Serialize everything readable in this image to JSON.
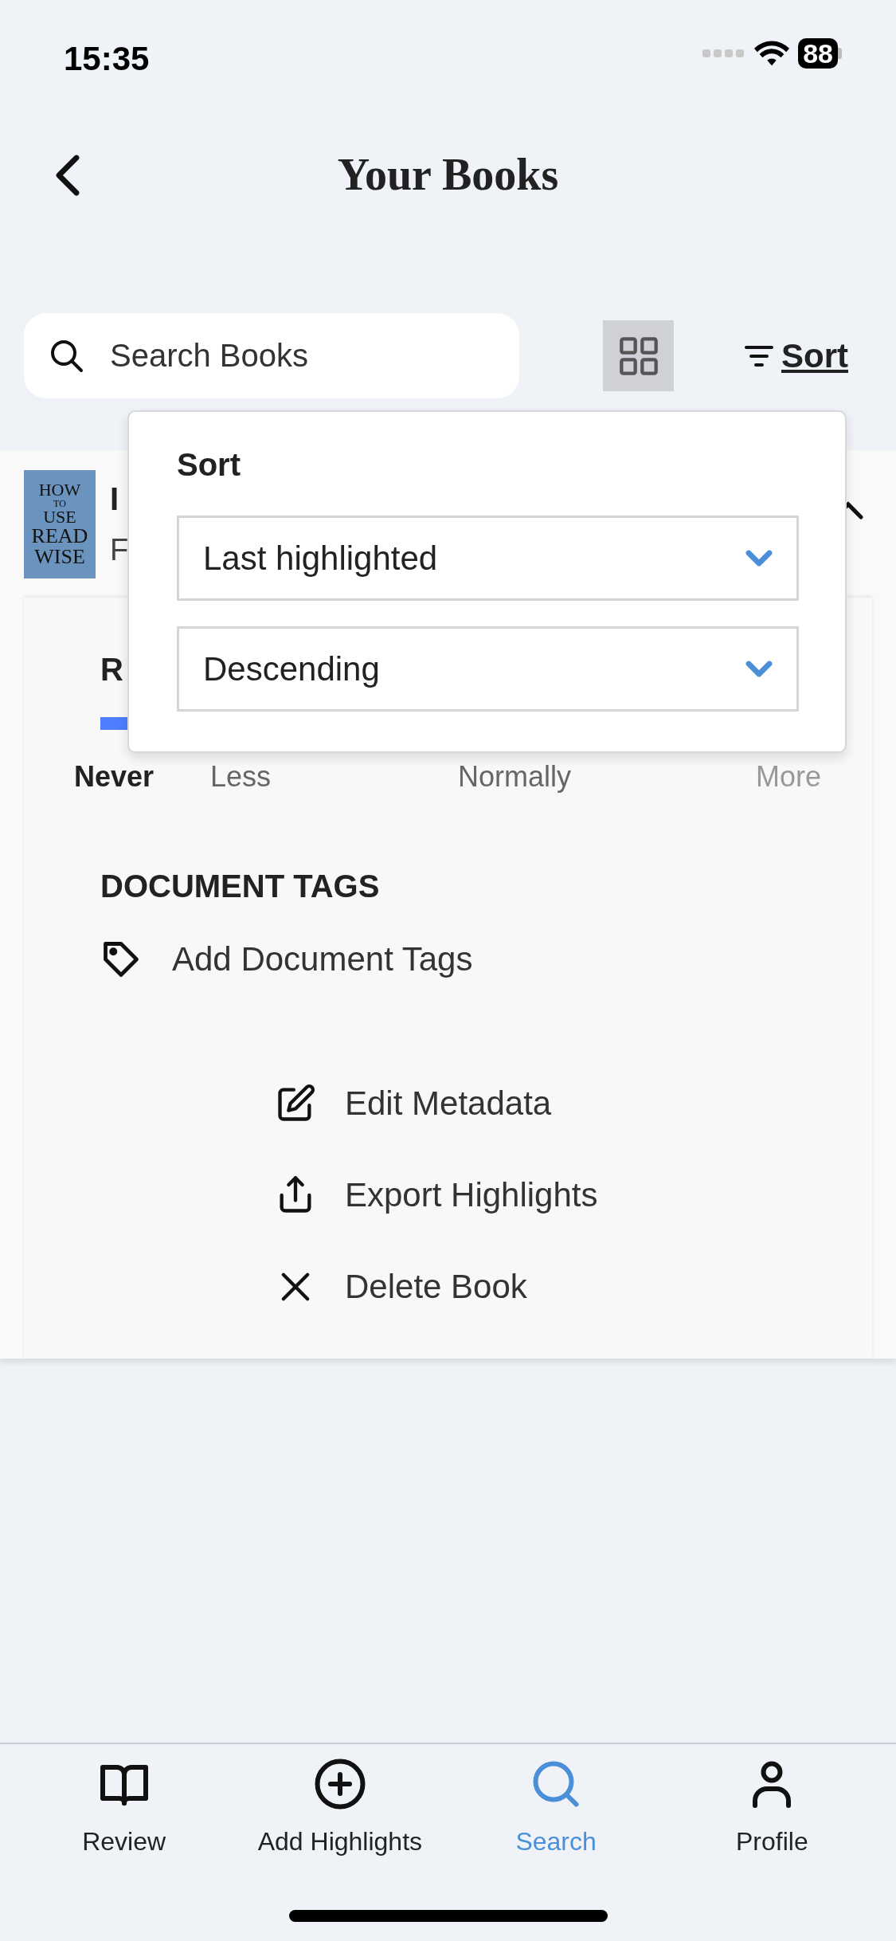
{
  "status_bar": {
    "time": "15:35",
    "battery": "88"
  },
  "header": {
    "title": "Your Books"
  },
  "search": {
    "placeholder": "Search Books"
  },
  "toolbar": {
    "sort_label": "Sort"
  },
  "book": {
    "cover_lines": [
      "HOW",
      "TO",
      "USE",
      "READ",
      "WISE"
    ],
    "title": "I",
    "author": "F",
    "expanded": true
  },
  "reading_section": {
    "heading": "R",
    "options": [
      {
        "label": "Never",
        "selected": true
      },
      {
        "label": "Less",
        "selected": false
      },
      {
        "label": "Normally",
        "selected": false
      },
      {
        "label": "More",
        "selected": false
      }
    ]
  },
  "tags_section": {
    "heading": "DOCUMENT TAGS",
    "add_label": "Add Document Tags"
  },
  "actions": [
    {
      "kind": "edit",
      "label": "Edit Metadata"
    },
    {
      "kind": "export",
      "label": "Export Highlights"
    },
    {
      "kind": "delete",
      "label": "Delete Book"
    }
  ],
  "sort_popup": {
    "title": "Sort",
    "fields": [
      {
        "value": "Last highlighted"
      },
      {
        "value": "Descending"
      }
    ]
  },
  "tab_bar": [
    {
      "kind": "review",
      "label": "Review",
      "selected": false
    },
    {
      "kind": "add",
      "label": "Add Highlights",
      "selected": false
    },
    {
      "kind": "search",
      "label": "Search",
      "selected": true
    },
    {
      "kind": "profile",
      "label": "Profile",
      "selected": false
    }
  ]
}
